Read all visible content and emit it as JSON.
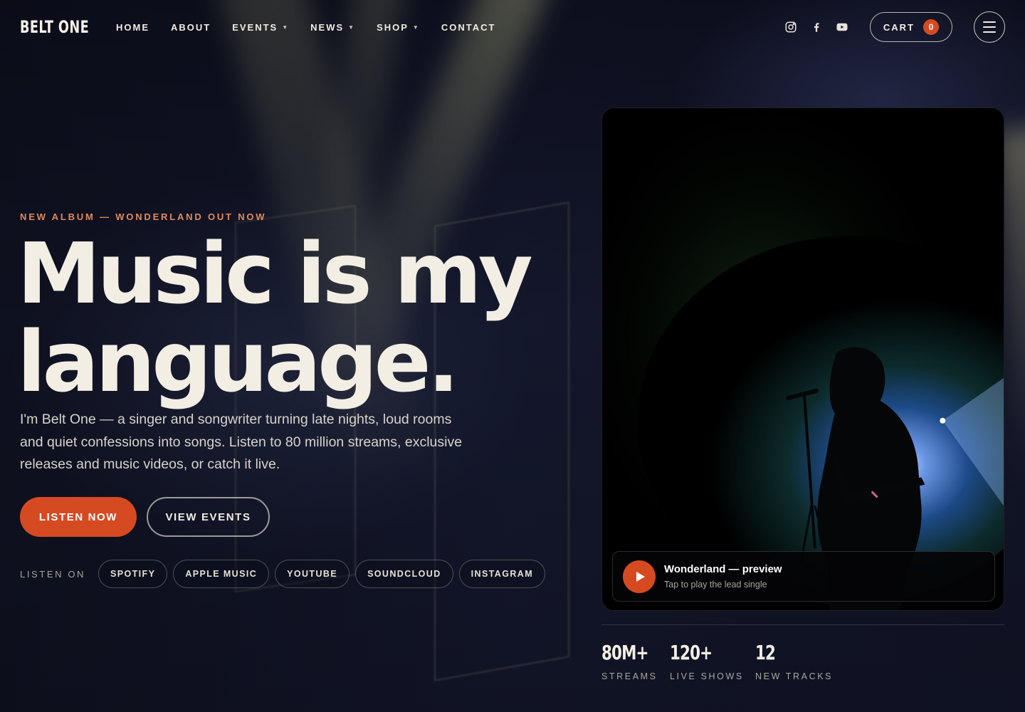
{
  "brand": {
    "logo_text": "BELT ONE"
  },
  "nav": {
    "items": [
      {
        "label": "HOME",
        "has_dropdown": false
      },
      {
        "label": "ABOUT",
        "has_dropdown": false
      },
      {
        "label": "EVENTS",
        "has_dropdown": true
      },
      {
        "label": "NEWS",
        "has_dropdown": true
      },
      {
        "label": "SHOP",
        "has_dropdown": true
      },
      {
        "label": "CONTACT",
        "has_dropdown": false
      }
    ],
    "social_icons": [
      "instagram-icon",
      "facebook-icon",
      "youtube-icon"
    ],
    "cart": {
      "label": "CART",
      "count": "0"
    },
    "menu_icon": "hamburger-menu-icon"
  },
  "hero": {
    "eyebrow": "NEW ALBUM — WONDERLAND OUT NOW",
    "headline_line1": "Music is my",
    "headline_line2": "language.",
    "lede": "I'm Belt One — a singer and songwriter turning late nights, loud rooms and quiet confessions into songs. Listen to 80 million streams, exclusive releases and music videos, or catch it live.",
    "primary_button": "LISTEN NOW",
    "secondary_button": "VIEW EVENTS",
    "listen_on_label": "LISTEN ON",
    "platforms": [
      "SPOTIFY",
      "APPLE MUSIC",
      "YOUTUBE",
      "SOUNDCLOUD",
      "INSTAGRAM"
    ]
  },
  "player": {
    "title": "Wonderland — preview",
    "subtitle": "Tap to play the lead single",
    "play_icon": "play-icon"
  },
  "stats": [
    {
      "value": "80M+",
      "label": "STREAMS"
    },
    {
      "value": "120+",
      "label": "LIVE SHOWS"
    },
    {
      "value": "12",
      "label": "NEW TRACKS"
    }
  ],
  "colors": {
    "accent": "#d64a22",
    "eyebrow": "#e08a5a",
    "text": "#f3eee4",
    "background": "#0b0d1a"
  }
}
